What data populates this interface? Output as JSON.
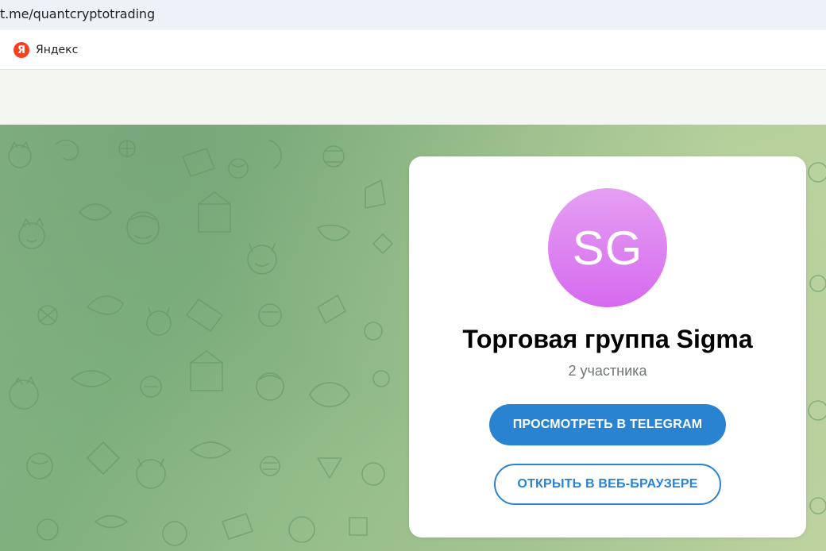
{
  "browser": {
    "url": "t.me/quantcryptotrading",
    "bookmark_label": "Яндекс",
    "bookmark_icon": "Я"
  },
  "group": {
    "avatar_initials": "SG",
    "title": "Торговая группа Sigma",
    "members": "2 участника"
  },
  "actions": {
    "open_telegram": "ПРОСМОТРЕТЬ В TELEGRAM",
    "open_web": "ОТКРЫТЬ В ВЕБ-БРАУЗЕРЕ"
  },
  "colors": {
    "accent": "#2a83d1",
    "avatar_top": "#e59ff2",
    "avatar_bottom": "#d66aef",
    "yandex": "#fc3f1d"
  }
}
